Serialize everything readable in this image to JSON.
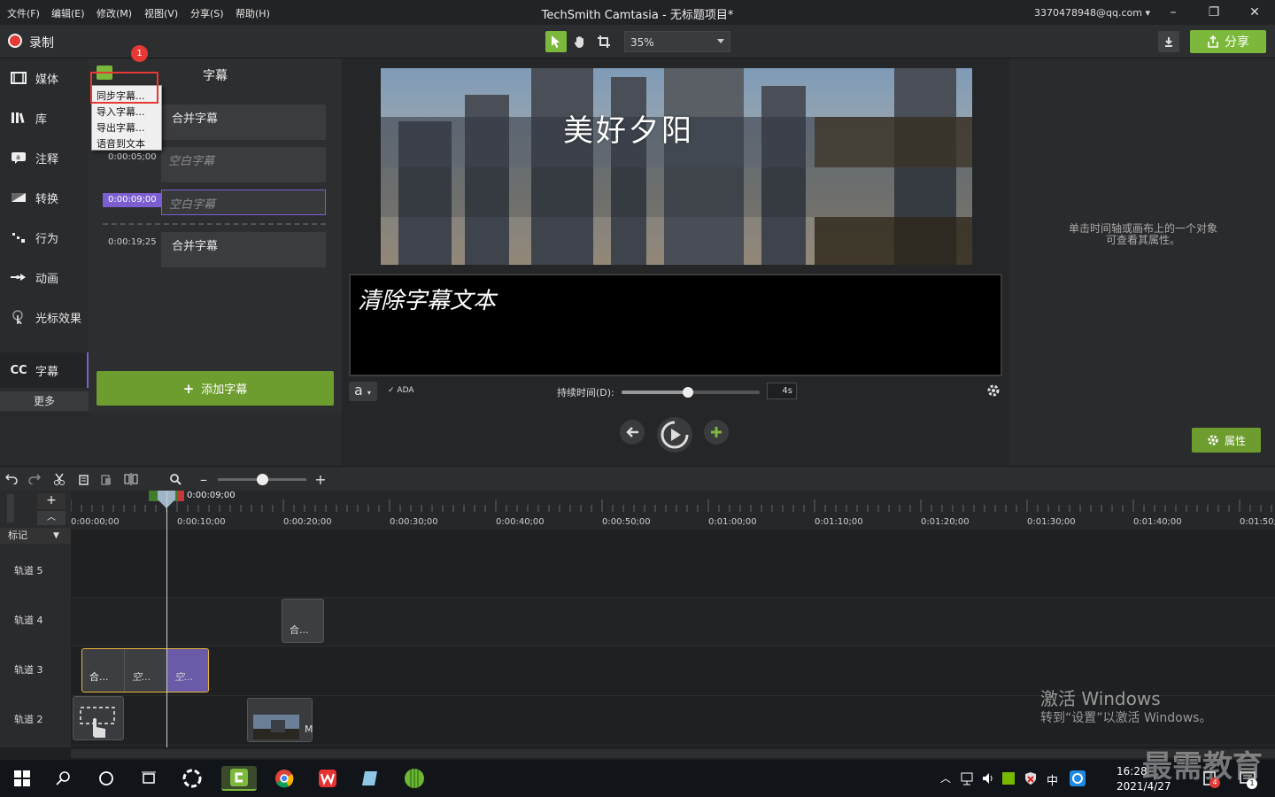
{
  "window": {
    "menu": [
      "文件(F)",
      "编辑(E)",
      "修改(M)",
      "视图(V)",
      "分享(S)",
      "帮助(H)"
    ],
    "title": "TechSmith Camtasia - 无标题项目*",
    "user": "3370478948@qq.com"
  },
  "toolbar": {
    "record_label": "录制",
    "zoom_value": "35%",
    "share_label": "分享"
  },
  "nav": {
    "items": [
      "媒体",
      "库",
      "注释",
      "转换",
      "行为",
      "动画",
      "光标效果",
      "字幕"
    ],
    "cc_icon": "CC",
    "more": "更多"
  },
  "captions": {
    "title": "字幕",
    "rows": [
      {
        "time": "",
        "text": "合并字幕"
      },
      {
        "time": "0:00:05;00",
        "text": "空白字幕"
      },
      {
        "time": "0:00:09;00",
        "text": "空白字幕"
      },
      {
        "time": "0:00:19;25",
        "text": "合并字幕"
      }
    ],
    "add_button": "添加字幕",
    "menu": [
      "同步字幕...",
      "导入字幕...",
      "导出字幕...",
      "语音到文本"
    ],
    "badge": "1"
  },
  "canvas": {
    "video_title": "美好夕阳",
    "caption_placeholder": "清除字幕文本",
    "font_button": "a",
    "ada_label": "ADA",
    "duration_label": "持续时间(D):",
    "duration_value": "4s",
    "duration_fraction": 0.48
  },
  "properties": {
    "hint_line1": "单击时间轴或画布上的一个对象",
    "hint_line2": "可查看其属性。",
    "button": "属性"
  },
  "timeline": {
    "playhead_time": "0:00:09;00",
    "markers_label": "标记",
    "ticks": [
      "0:00:00;00",
      "0:00:10;00",
      "0:00:20;00",
      "0:00:30;00",
      "0:00:40;00",
      "0:00:50;00",
      "0:01:00;00",
      "0:01:10;00",
      "0:01:20;00",
      "0:01:30;00",
      "0:01:40;00",
      "0:01:50;"
    ],
    "tracks": [
      "轨道 5",
      "轨道 4",
      "轨道 3",
      "轨道 2"
    ],
    "clip_track4": "合...",
    "clip_track3_segments": [
      "合...",
      "空...",
      "空..."
    ],
    "clip_track2_tail": "M"
  },
  "system": {
    "time": "16:28",
    "date": "2021/4/27",
    "ime": "中",
    "notify_count": "4",
    "action_count": "1",
    "watermark_title": "激活 Windows",
    "watermark_sub": "转到“设置”以激活 Windows。",
    "brand_mark": "最需教育"
  },
  "colors": {
    "accent_green": "#7cb83b",
    "accent_purple": "#7b5fd0",
    "highlight_red": "#e53935"
  }
}
